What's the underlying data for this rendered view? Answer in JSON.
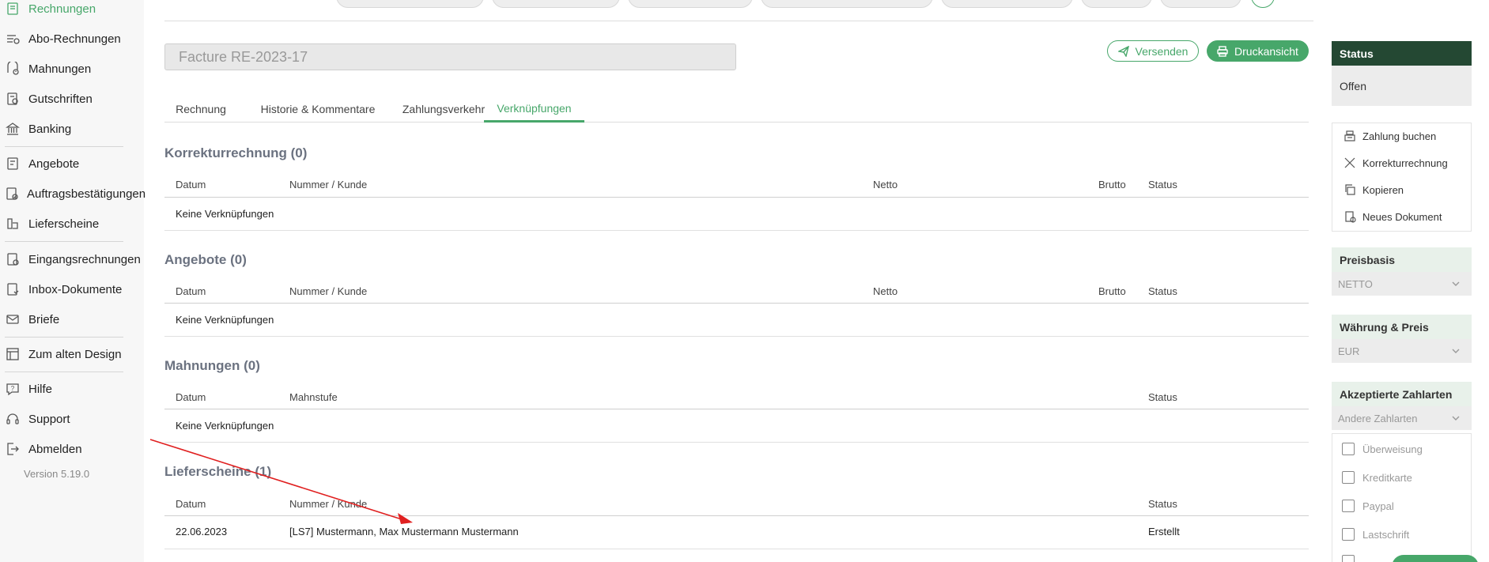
{
  "sidebar": {
    "items": [
      {
        "label": "Rechnungen",
        "icon": "invoice-icon",
        "active": true
      },
      {
        "label": "Abo-Rechnungen",
        "icon": "subscription-icon"
      },
      {
        "label": "Mahnungen",
        "icon": "reminder-icon"
      },
      {
        "label": "Gutschriften",
        "icon": "credit-note-icon"
      },
      {
        "label": "Banking",
        "icon": "bank-icon"
      },
      {
        "label": "Angebote",
        "icon": "offer-icon"
      },
      {
        "label": "Auftragsbestätigungen",
        "icon": "order-confirmation-icon"
      },
      {
        "label": "Lieferscheine",
        "icon": "delivery-note-icon"
      },
      {
        "label": "Eingangsrechnungen",
        "icon": "incoming-invoice-icon"
      },
      {
        "label": "Inbox-Dokumente",
        "icon": "inbox-icon"
      },
      {
        "label": "Briefe",
        "icon": "letter-icon"
      },
      {
        "label": "Zum alten Design",
        "icon": "layout-icon"
      },
      {
        "label": "Hilfe",
        "icon": "help-icon"
      },
      {
        "label": "Support",
        "icon": "headset-icon"
      },
      {
        "label": "Abmelden",
        "icon": "logout-icon"
      }
    ],
    "version": "Version 5.19.0"
  },
  "document": {
    "title": "Facture RE-2023-17",
    "send_label": "Versenden",
    "print_label": "Druckansicht"
  },
  "tabs": [
    {
      "label": "Rechnung"
    },
    {
      "label": "Historie & Kommentare"
    },
    {
      "label": "Zahlungsverkehr"
    },
    {
      "label": "Verknüpfungen",
      "active": true
    }
  ],
  "sections": {
    "korrektur": {
      "title": "Korrekturrechnung (0)",
      "headers": {
        "datum": "Datum",
        "nummer": "Nummer / Kunde",
        "netto": "Netto",
        "brutto": "Brutto",
        "status": "Status"
      },
      "empty": "Keine Verknüpfungen"
    },
    "angebote": {
      "title": "Angebote (0)",
      "headers": {
        "datum": "Datum",
        "nummer": "Nummer / Kunde",
        "netto": "Netto",
        "brutto": "Brutto",
        "status": "Status"
      },
      "empty": "Keine Verknüpfungen"
    },
    "mahnungen": {
      "title": "Mahnungen (0)",
      "headers": {
        "datum": "Datum",
        "mahnstufe": "Mahnstufe",
        "status": "Status"
      },
      "empty": "Keine Verknüpfungen"
    },
    "lieferscheine": {
      "title": "Lieferscheine (1)",
      "headers": {
        "datum": "Datum",
        "nummer": "Nummer / Kunde",
        "status": "Status"
      },
      "rows": [
        {
          "datum": "22.06.2023",
          "nummer": "[LS7] Mustermann, Max Mustermann Mustermann",
          "status": "Erstellt"
        }
      ]
    }
  },
  "right_panel": {
    "status_title": "Status",
    "status_value": "Offen",
    "actions": [
      {
        "label": "Zahlung buchen",
        "icon": "cash-register-icon"
      },
      {
        "label": "Korrekturrechnung",
        "icon": "close-icon"
      },
      {
        "label": "Kopieren",
        "icon": "copy-icon"
      },
      {
        "label": "Neues Dokument",
        "icon": "new-document-icon"
      }
    ],
    "preisbasis": {
      "title": "Preisbasis",
      "value": "NETTO"
    },
    "waehrung": {
      "title": "Währung & Preis",
      "value": "EUR"
    },
    "zahlarten": {
      "title": "Akzeptierte Zahlarten",
      "select": "Andere Zahlarten",
      "options": [
        "Überweisung",
        "Kreditkarte",
        "Paypal",
        "Lastschrift"
      ]
    }
  },
  "colors": {
    "accent": "#47a76a",
    "status_header": "#244833",
    "section_title": "#6b7280",
    "annotation_arrow": "#e02020"
  }
}
